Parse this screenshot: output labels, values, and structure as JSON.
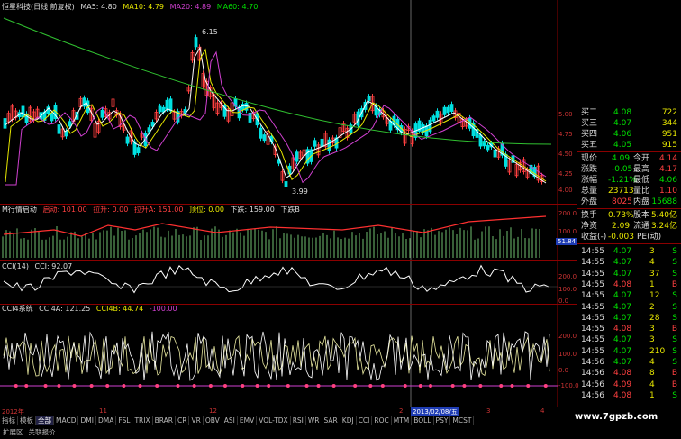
{
  "main_header": {
    "title": "恒星科技(日线 前复权)",
    "ma5": "MA5: 4.80",
    "ma10": "MA10: 4.79",
    "ma20": "MA20: 4.89",
    "ma60": "MA60: 4.70"
  },
  "main_annotations": {
    "high": "6.15",
    "low": "3.99"
  },
  "price_scale": [
    "5.00",
    "4.75",
    "4.50",
    "4.25",
    "4.00"
  ],
  "ind1_header": {
    "name": "M行情启动",
    "a": "启动: 101.00",
    "b": "拉升: 0.00",
    "c": "拉升A: 151.00",
    "d": "顶位: 0.00",
    "e": "下跌: 159.00",
    "f": "下跌B"
  },
  "ind1_scale": [
    "200.0",
    "100.0"
  ],
  "ind1_marker": "51.84",
  "ind2_header": {
    "name": "CCI(14)",
    "v": "CCI: 92.07"
  },
  "ind2_scale": [
    "200.0",
    "100.0",
    "0.0"
  ],
  "ind3_header": {
    "name": "CCI4系统",
    "a": "CCI4A: 121.25",
    "b": "CCI4B: 44.74",
    "c": "-100.00"
  },
  "ind3_scale": [
    "200.0",
    "100.0",
    "0.0",
    "-100.0"
  ],
  "time_axis": {
    "year": "2012年",
    "m1": "11",
    "m2": "12",
    "m3": "2",
    "m4": "3",
    "m5": "4",
    "cursor_date": "2013/02/08/五"
  },
  "tabs": [
    "指标",
    "模板",
    "全部",
    "MACD",
    "DMI",
    "DMA",
    "FSL",
    "TRIX",
    "BRAR",
    "CR",
    "VR",
    "OBV",
    "ASI",
    "EMV",
    "VOL-TDX",
    "RSI",
    "WR",
    "SAR",
    "KDJ",
    "CCI",
    "ROC",
    "MTM",
    "BOLL",
    "PSY",
    "MCST"
  ],
  "tabs2": [
    "扩展区",
    "关联报价"
  ],
  "watermark": "www.7gpzb.com",
  "quote": {
    "asks": [
      {
        "label": "买二",
        "price": "4.08",
        "vol": "722"
      },
      {
        "label": "买三",
        "price": "4.07",
        "vol": "344"
      },
      {
        "label": "买四",
        "price": "4.06",
        "vol": "951"
      },
      {
        "label": "买五",
        "price": "4.05",
        "vol": "915"
      }
    ],
    "stats": [
      {
        "l1": "现价",
        "v1": "4.09",
        "l2": "今开",
        "v2": "4.14"
      },
      {
        "l1": "涨跌",
        "v1": "-0.05",
        "l2": "最高",
        "v2": "4.17"
      },
      {
        "l1": "涨幅",
        "v1": "-1.21%",
        "l2": "最低",
        "v2": "4.06"
      },
      {
        "l1": "总量",
        "v1": "23713",
        "l2": "量比",
        "v2": "1.10"
      },
      {
        "l1": "外盘",
        "v1": "8025",
        "l2": "内盘",
        "v2": "15688"
      },
      {
        "l1": "换手",
        "v1": "0.73%",
        "l2": "股本",
        "v2": "5.40亿"
      },
      {
        "l1": "净资",
        "v1": "2.09",
        "l2": "流通",
        "v2": "3.24亿"
      },
      {
        "l1": "收益(-)",
        "v1": "-0.003",
        "l2": "PE(动)",
        "v2": ""
      }
    ],
    "ticks": [
      {
        "t": "14:55",
        "p": "4.07",
        "v": "3",
        "s": "S"
      },
      {
        "t": "14:55",
        "p": "4.07",
        "v": "4",
        "s": "S"
      },
      {
        "t": "14:55",
        "p": "4.07",
        "v": "37",
        "s": "S"
      },
      {
        "t": "14:55",
        "p": "4.08",
        "v": "1",
        "s": "B"
      },
      {
        "t": "14:55",
        "p": "4.07",
        "v": "12",
        "s": "S"
      },
      {
        "t": "14:55",
        "p": "4.07",
        "v": "2",
        "s": "S"
      },
      {
        "t": "14:55",
        "p": "4.07",
        "v": "28",
        "s": "S"
      },
      {
        "t": "14:55",
        "p": "4.08",
        "v": "3",
        "s": "B"
      },
      {
        "t": "14:55",
        "p": "4.07",
        "v": "3",
        "s": "S"
      },
      {
        "t": "14:55",
        "p": "4.07",
        "v": "210",
        "s": "S"
      },
      {
        "t": "14:56",
        "p": "4.07",
        "v": "4",
        "s": "S"
      },
      {
        "t": "14:56",
        "p": "4.08",
        "v": "8",
        "s": "B"
      },
      {
        "t": "14:56",
        "p": "4.09",
        "v": "4",
        "s": "B"
      },
      {
        "t": "14:56",
        "p": "4.08",
        "v": "1",
        "s": "S"
      }
    ]
  },
  "colors": {
    "up": "#ff4040",
    "down": "#00e0e0",
    "ma5": "#ffffff",
    "ma10": "#e8e800",
    "ma20": "#d040d0",
    "ma60": "#30c030"
  }
}
